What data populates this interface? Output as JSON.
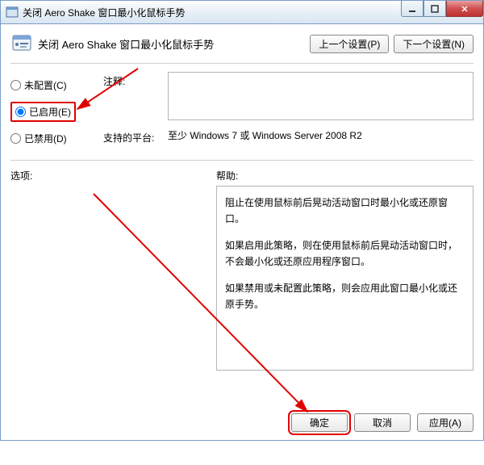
{
  "window": {
    "title": "关闭 Aero Shake 窗口最小化鼠标手势"
  },
  "header": {
    "title": "关闭 Aero Shake 窗口最小化鼠标手势",
    "prev": "上一个设置(P)",
    "next": "下一个设置(N)"
  },
  "radios": {
    "not_configured": "未配置(C)",
    "enabled": "已启用(E)",
    "disabled": "已禁用(D)"
  },
  "labels": {
    "comment": "注释:",
    "platform": "支持的平台:",
    "options": "选项:",
    "help": "帮助:"
  },
  "platform_value": "至少 Windows 7 或 Windows Server 2008 R2",
  "help": {
    "p1": "阻止在使用鼠标前后晃动活动窗口时最小化或还原窗口。",
    "p2": "如果启用此策略，则在使用鼠标前后晃动活动窗口时，不会最小化或还原应用程序窗口。",
    "p3": "如果禁用或未配置此策略，则会应用此窗口最小化或还原手势。"
  },
  "buttons": {
    "ok": "确定",
    "cancel": "取消",
    "apply": "应用(A)"
  }
}
